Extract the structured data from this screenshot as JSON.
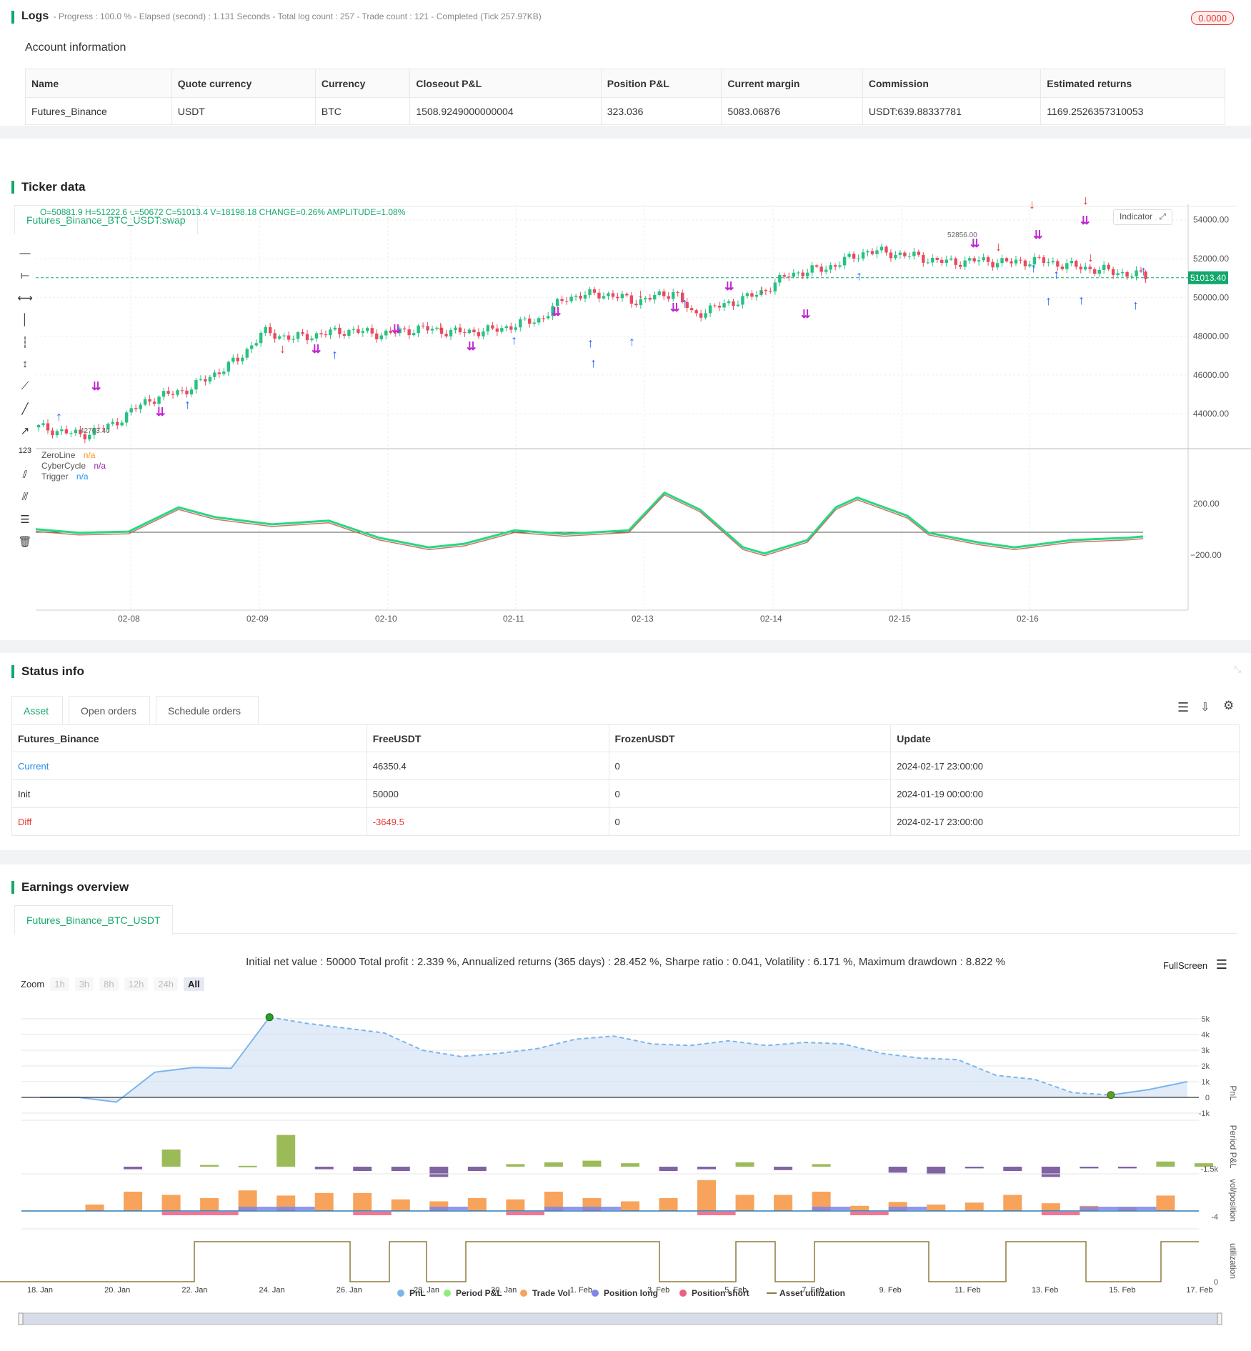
{
  "logs": {
    "title": "Logs",
    "summary": "- Progress : 100.0 % - Elapsed (second) : 1.131  Seconds - Total log count : 257 - Trade count : 121 - Completed (Tick 257.97KB)",
    "badge": "0.0000"
  },
  "account": {
    "title": "Account information",
    "headers": [
      "Name",
      "Quote currency",
      "Currency",
      "Closeout P&L",
      "Position P&L",
      "Current margin",
      "Commission",
      "Estimated returns"
    ],
    "row": [
      "Futures_Binance",
      "USDT",
      "BTC",
      "1508.9249000000004",
      "323.036",
      "5083.06876",
      "USDT:639.88337781",
      "1169.2526357310053"
    ]
  },
  "ticker": {
    "title": "Ticker data",
    "tab": "Futures_Binance_BTC_USDT:swap",
    "ohlc": "O=50881.9 H=51222.6 L=50672 C=51013.4 V=18198.18 CHANGE=0.26% AMPLITUDE=1.08%",
    "indicator_btn": "Indicator",
    "last_price": "51013.40",
    "y_ticks": [
      "54000.00",
      "52000.00",
      "50000.00",
      "48000.00",
      "46000.00",
      "44000.00"
    ],
    "osc_ticks": [
      "200.00",
      "−200.00"
    ],
    "x_ticks": [
      "02-08",
      "02-09",
      "02-10",
      "02-11",
      "02-13",
      "02-14",
      "02-15",
      "02-16"
    ],
    "legend": [
      {
        "name": "ZeroLine",
        "value": "n/a",
        "color": "#f7931a"
      },
      {
        "name": "CyberCycle",
        "value": "n/a",
        "color": "#9c27b0"
      },
      {
        "name": "Trigger",
        "value": "n/a",
        "color": "#2196f3"
      }
    ],
    "high_label": "52856.00",
    "low_label": "42763.40"
  },
  "status": {
    "title": "Status info",
    "tabs": [
      "Asset",
      "Open orders",
      "Schedule orders"
    ],
    "headers": [
      "Futures_Binance",
      "FreeUSDT",
      "FrozenUSDT",
      "Update"
    ],
    "rows": [
      [
        "Current",
        "46350.4",
        "0",
        "2024-02-17 23:00:00"
      ],
      [
        "Init",
        "50000",
        "0",
        "2024-01-19 00:00:00"
      ],
      [
        "Diff",
        "-3649.5",
        "0",
        "2024-02-17 23:00:00"
      ]
    ]
  },
  "earnings": {
    "title": "Earnings overview",
    "tab": "Futures_Binance_BTC_USDT",
    "summary": "Initial net value : 50000 Total profit : 2.339 %, Annualized returns (365 days) : 28.452 %, Sharpe ratio : 0.041, Volatility : 6.171 %, Maximum drawdown : 8.822 %",
    "fullscreen": "FullScreen",
    "zoom_label": "Zoom",
    "zoom_options": [
      "1h",
      "3h",
      "8h",
      "12h",
      "24h",
      "All"
    ],
    "pnl_ticks": [
      "5k",
      "4k",
      "3k",
      "2k",
      "1k",
      "0",
      "-1k"
    ],
    "axis_labels": [
      "PnL",
      "Period P&L",
      "vol/position",
      "utilization"
    ],
    "period_tick": "-1.5k",
    "vol_tick": "-4",
    "util_tick": "0",
    "x_ticks": [
      "18. Jan",
      "20. Jan",
      "22. Jan",
      "24. Jan",
      "26. Jan",
      "28. Jan",
      "30. Jan",
      "1. Feb",
      "3. Feb",
      "5. Feb",
      "7. Feb",
      "9. Feb",
      "11. Feb",
      "13. Feb",
      "15. Feb",
      "17. Feb"
    ],
    "legend": [
      {
        "name": "PnL",
        "color": "#7cb5ec"
      },
      {
        "name": "Period P&L",
        "color": "#90ed7d"
      },
      {
        "name": "Trade Vol",
        "color": "#f7a35c"
      },
      {
        "name": "Position long",
        "color": "#8085e9"
      },
      {
        "name": "Position short",
        "color": "#f15c80"
      },
      {
        "name": "Asset utilization",
        "color": "#8d7a3f"
      }
    ]
  },
  "colors": {
    "accent": "#13a86b",
    "up": "#26c281",
    "down": "#e84a5f",
    "red": "#e53935",
    "blue": "#3f51b5"
  }
}
